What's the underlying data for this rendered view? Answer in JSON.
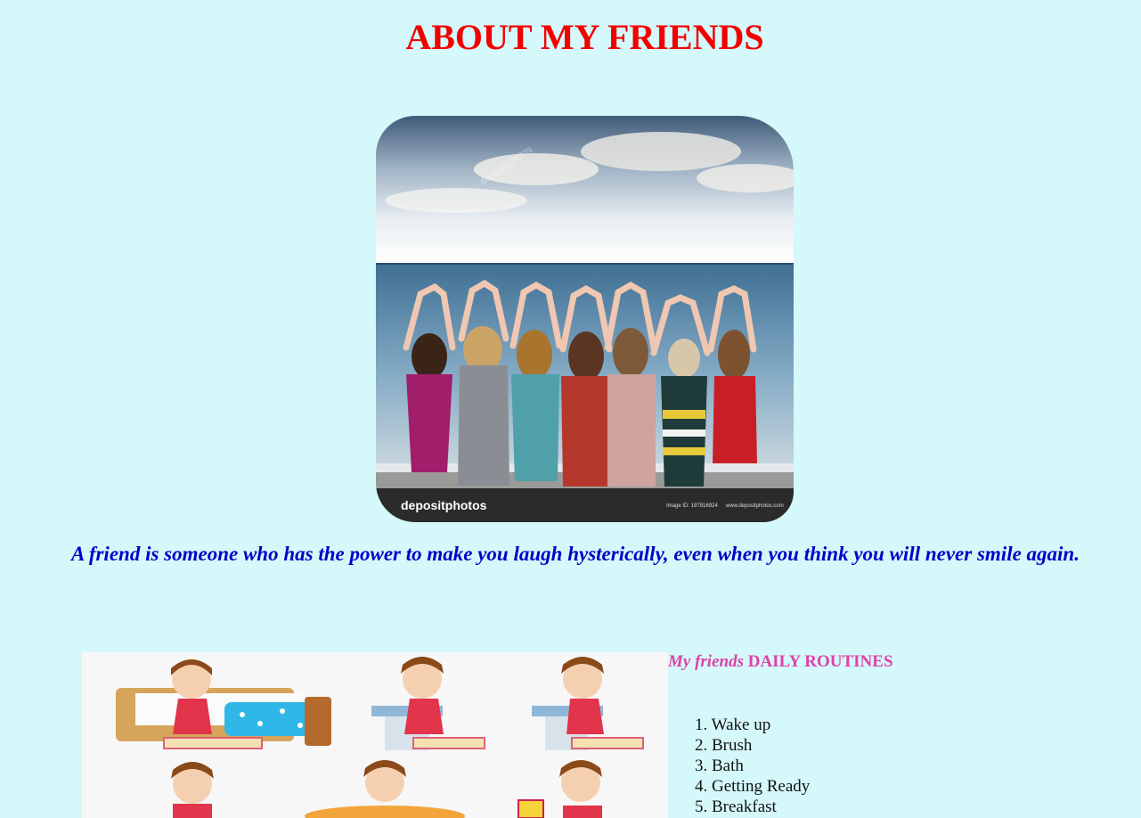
{
  "page": {
    "title": "ABOUT MY FRIENDS",
    "quote": "A friend is someone who has the power to make you laugh hysterically, even when you think you will never smile again."
  },
  "hero_image": {
    "watermark_brand": "depositphotos",
    "watermark_small": "depositphotos",
    "image_id": "Image ID: 197816924",
    "site": "www.depositphotos.com"
  },
  "routines": {
    "heading_italic": "My friends",
    "heading_rest": "DAILY ROUTINES",
    "items": [
      {
        "num": "1.",
        "label": "Wake up"
      },
      {
        "num": "2.",
        "label": "Brush"
      },
      {
        "num": "3.",
        "label": "Bath"
      },
      {
        "num": "4.",
        "label": "Getting Ready"
      },
      {
        "num": "5.",
        "label": "Breakfast"
      }
    ]
  },
  "colors": {
    "background": "#d5f8fa",
    "title": "#f20000",
    "quote": "#0000c8",
    "routine_heading": "#e040a8"
  }
}
